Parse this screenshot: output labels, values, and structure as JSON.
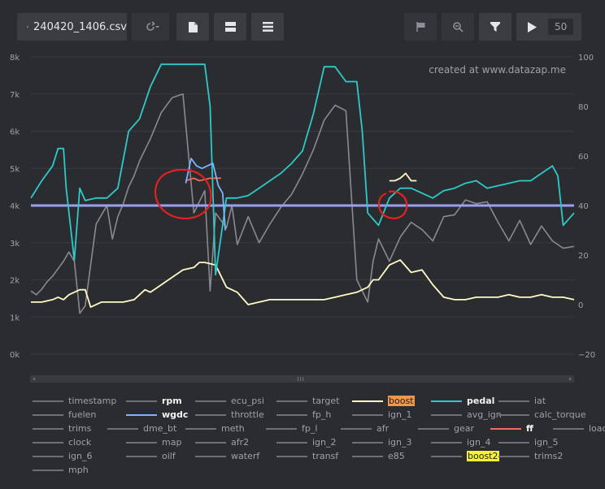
{
  "toolbar": {
    "file_name": "240420_1406.csv",
    "zoom_value": "50",
    "icons": [
      "external-open-icon",
      "refresh-icon",
      "document-icon",
      "split-view-icon",
      "list-view-icon",
      "flag-icon",
      "zoom-icon",
      "filter-icon",
      "play-icon"
    ]
  },
  "watermark": "created at www.datazap.me",
  "colors": {
    "background": "#2b2c30",
    "grid": "#3a3b40",
    "boost": "#fffbc8",
    "pedal": "#2fc9c9",
    "wgdc": "#7bb4ff",
    "ff": "#f06d57",
    "target": "#9aa0f0",
    "gray": "#8a8a8e",
    "annotation": "#e52020"
  },
  "chart_data": {
    "type": "line",
    "y_left": {
      "ticks": [
        "0k",
        "1k",
        "2k",
        "3k",
        "4k",
        "5k",
        "6k",
        "7k",
        "8k"
      ],
      "ylim": [
        0,
        8000
      ]
    },
    "y_right": {
      "ticks": [
        "−20",
        "0",
        "20",
        "40",
        "60",
        "80",
        "100"
      ],
      "ylim": [
        -20,
        100
      ]
    },
    "grid": true,
    "series": [
      {
        "name": "rpm",
        "axis": "left",
        "color": "#8a8a8e",
        "x": [
          0,
          1,
          2,
          3,
          4,
          5,
          6,
          7,
          8,
          9,
          10,
          12,
          14,
          15,
          16,
          17,
          18,
          19,
          20,
          22,
          24,
          26,
          28,
          30,
          32,
          33,
          34,
          36,
          37,
          38,
          40,
          42,
          44,
          46,
          48,
          50,
          52,
          54,
          56,
          58,
          60,
          62,
          63,
          64,
          66,
          68,
          70,
          72,
          74,
          76,
          78,
          80,
          82,
          84,
          86,
          88,
          90,
          92,
          94,
          96,
          98,
          100
        ],
        "values": [
          1700,
          1600,
          1750,
          1950,
          2100,
          2300,
          2500,
          2750,
          2500,
          1100,
          1300,
          3500,
          4000,
          3100,
          3700,
          4050,
          4500,
          4800,
          5200,
          5800,
          6500,
          6900,
          7000,
          3800,
          4400,
          1700,
          3800,
          3400,
          4000,
          2950,
          3700,
          3000,
          3500,
          3950,
          4300,
          4850,
          5500,
          6300,
          6700,
          6550,
          2000,
          1400,
          2500,
          3100,
          2500,
          3150,
          3550,
          3350,
          3050,
          3700,
          3750,
          4150,
          4050,
          4100,
          3550,
          3050,
          3600,
          2950,
          3450,
          3050,
          2850,
          2900
        ]
      },
      {
        "name": "pedal",
        "axis": "right",
        "color": "#2fc9c9",
        "x": [
          0,
          2,
          4,
          5,
          6,
          6.5,
          8,
          9,
          10,
          12,
          14,
          16,
          18,
          20,
          22,
          24,
          26,
          28,
          30,
          32,
          33,
          34,
          36,
          38,
          40,
          42,
          44,
          46,
          48,
          50,
          52,
          54,
          56,
          58,
          60,
          61,
          62,
          64,
          66,
          68,
          70,
          72,
          74,
          76,
          78,
          80,
          82,
          84,
          86,
          88,
          90,
          92,
          94,
          96,
          97,
          98,
          100
        ],
        "values": [
          43,
          50,
          56,
          63,
          63,
          47,
          18,
          47,
          42,
          43,
          43,
          47,
          70,
          75,
          88,
          97,
          97,
          97,
          97,
          97,
          80,
          12,
          43,
          43,
          44,
          47,
          50,
          53,
          57,
          62,
          77,
          96,
          96,
          90,
          90,
          70,
          37,
          32,
          43,
          47,
          47,
          45,
          43,
          46,
          47,
          49,
          50,
          47,
          48,
          49,
          50,
          50,
          53,
          56,
          52,
          32,
          37
        ]
      },
      {
        "name": "boost",
        "axis": "right",
        "color": "#fffbc8",
        "x": [
          0,
          2,
          4,
          5,
          6,
          7,
          9,
          10,
          11,
          13,
          15,
          17,
          19,
          21,
          22,
          24,
          26,
          28,
          30,
          31,
          32,
          34,
          36,
          38,
          40,
          42,
          44,
          46,
          48,
          50,
          52,
          54,
          56,
          58,
          60,
          62,
          63,
          64,
          66,
          68,
          70,
          72,
          74,
          76,
          78,
          80,
          82,
          84,
          86,
          88,
          90,
          92,
          94,
          96,
          98,
          100
        ],
        "values": [
          1,
          1,
          2,
          3,
          2,
          4,
          6,
          6,
          -1,
          1,
          1,
          1,
          2,
          6,
          5,
          8,
          11,
          14,
          15,
          17,
          17,
          16,
          7,
          5,
          0,
          1,
          2,
          2,
          2,
          2,
          2,
          2,
          3,
          4,
          5,
          7,
          10,
          10,
          16,
          18,
          13,
          14,
          8,
          3,
          2,
          2,
          3,
          3,
          3,
          4,
          3,
          3,
          4,
          3,
          3,
          2
        ]
      },
      {
        "name": "wgdc",
        "axis": "right",
        "color": "#7bb4ff",
        "x": [
          28.5,
          29.5,
          30.5,
          31.5,
          32.5,
          33.5,
          34.5,
          35.3,
          35.8
        ],
        "values": [
          49,
          59,
          56,
          55,
          56,
          57,
          48,
          45,
          30
        ]
      },
      {
        "name": "ff",
        "axis": "right",
        "color": "#f06d57",
        "x": [
          28.5,
          30,
          31,
          33,
          35
        ],
        "values": [
          50,
          51,
          50,
          51,
          51
        ]
      },
      {
        "name": "boost2",
        "axis": "right",
        "color": "#fffbc8",
        "x": [
          66,
          67,
          68,
          69,
          70,
          71
        ],
        "values": [
          50,
          50,
          51,
          53,
          50,
          50
        ]
      },
      {
        "name": "target",
        "axis": "left",
        "color": "#9aa0f0",
        "x": [
          0,
          100
        ],
        "values": [
          4000,
          4000
        ]
      }
    ]
  },
  "legend": {
    "rows": [
      [
        {
          "name": "timestamp"
        },
        {
          "name": "rpm",
          "active": true
        },
        {
          "name": "ecu_psi"
        },
        {
          "name": "target"
        },
        {
          "name": "boost",
          "highlight": "orange",
          "color": "#fffbc8"
        },
        {
          "name": "pedal",
          "active": true,
          "color": "#2fc9c9"
        },
        {
          "name": "iat"
        }
      ],
      [
        {
          "name": "fuelen"
        },
        {
          "name": "wgdc",
          "active": true,
          "color": "#7bb4ff"
        },
        {
          "name": "throttle"
        },
        {
          "name": "fp_h"
        },
        {
          "name": "ign_1"
        },
        {
          "name": "avg_ign"
        },
        {
          "name": "calc_torque"
        }
      ],
      [
        {
          "name": "trims"
        },
        {
          "name": "dme_bt"
        },
        {
          "name": "meth"
        },
        {
          "name": "fp_l"
        },
        {
          "name": "afr"
        },
        {
          "name": "gear"
        },
        {
          "name": "ff",
          "active": true,
          "color": "#f06d57"
        },
        {
          "name": "load"
        }
      ],
      [
        {
          "name": "clock"
        },
        {
          "name": "map"
        },
        {
          "name": "afr2"
        },
        {
          "name": "ign_2"
        },
        {
          "name": "ign_3"
        },
        {
          "name": "ign_4"
        },
        {
          "name": "ign_5"
        }
      ],
      [
        {
          "name": "ign_6"
        },
        {
          "name": "oilf"
        },
        {
          "name": "waterf"
        },
        {
          "name": "transf"
        },
        {
          "name": "e85"
        },
        {
          "name": "boost2",
          "highlight": "yellow"
        },
        {
          "name": "trims2"
        }
      ],
      [
        {
          "name": "mph"
        }
      ]
    ]
  }
}
